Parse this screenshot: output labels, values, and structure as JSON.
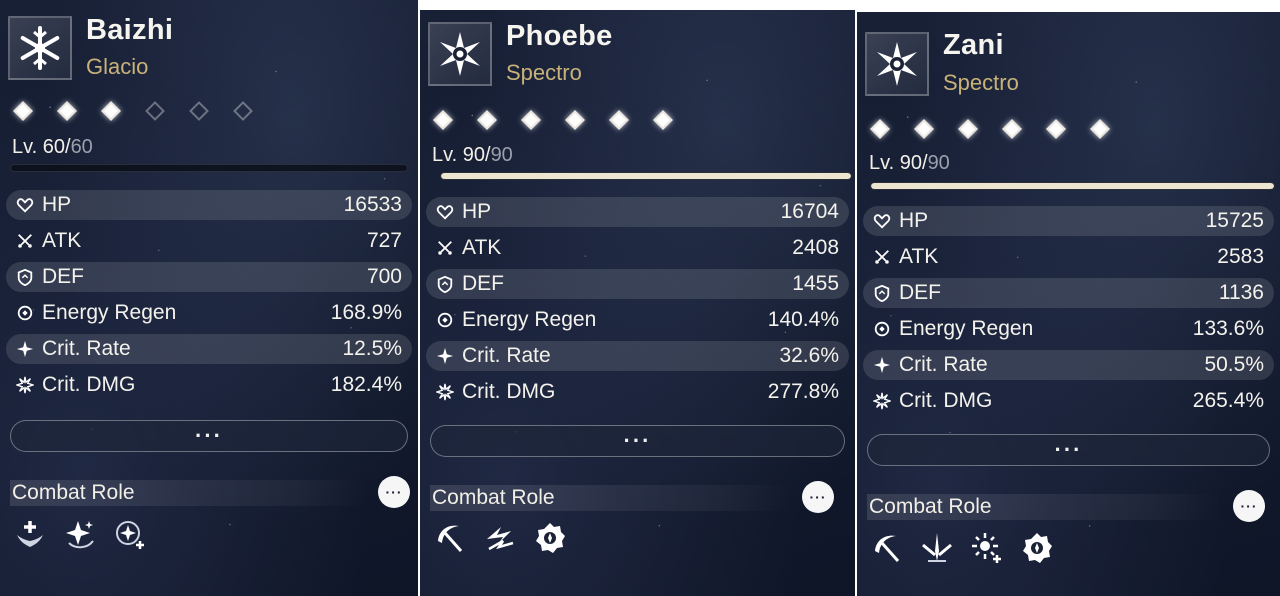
{
  "cards": [
    {
      "name": "Baizhi",
      "element": "Glacio",
      "element_icon": "snowflake-icon",
      "stars_filled": 3,
      "stars_total": 6,
      "level_current": "Lv. 60/",
      "level_max": "60",
      "level_progress": 0,
      "stats": [
        {
          "icon": "hp-heart-icon",
          "label": "HP",
          "value": "16533"
        },
        {
          "icon": "atk-swords-icon",
          "label": "ATK",
          "value": "727"
        },
        {
          "icon": "def-shield-icon",
          "label": "DEF",
          "value": "700"
        },
        {
          "icon": "energy-regen-icon",
          "label": "Energy Regen",
          "value": "168.9%"
        },
        {
          "icon": "crit-rate-icon",
          "label": "Crit. Rate",
          "value": "12.5%"
        },
        {
          "icon": "crit-dmg-icon",
          "label": "Crit. DMG",
          "value": "182.4%"
        }
      ],
      "more_label": "···",
      "combat_role_title": "Combat Role",
      "combat_role_more": "···",
      "roles": [
        "healing-wings-icon",
        "sparkle-buff-icon",
        "star-bonus-icon"
      ]
    },
    {
      "name": "Phoebe",
      "element": "Spectro",
      "element_icon": "spectro-star-icon",
      "stars_filled": 6,
      "stars_total": 6,
      "level_current": "Lv. 90/",
      "level_max": "90",
      "level_progress": 1,
      "stats": [
        {
          "icon": "hp-heart-icon",
          "label": "HP",
          "value": "16704"
        },
        {
          "icon": "atk-swords-icon",
          "label": "ATK",
          "value": "2408"
        },
        {
          "icon": "def-shield-icon",
          "label": "DEF",
          "value": "1455"
        },
        {
          "icon": "energy-regen-icon",
          "label": "Energy Regen",
          "value": "140.4%"
        },
        {
          "icon": "crit-rate-icon",
          "label": "Crit. Rate",
          "value": "32.6%"
        },
        {
          "icon": "crit-dmg-icon",
          "label": "Crit. DMG",
          "value": "277.8%"
        }
      ],
      "more_label": "···",
      "combat_role_title": "Combat Role",
      "combat_role_more": "···",
      "roles": [
        "slash-arc-icon",
        "lightning-strike-icon",
        "gear-emblem-icon"
      ]
    },
    {
      "name": "Zani",
      "element": "Spectro",
      "element_icon": "spectro-star-icon",
      "stars_filled": 6,
      "stars_total": 6,
      "level_current": "Lv. 90/",
      "level_max": "90",
      "level_progress": 1,
      "stats": [
        {
          "icon": "hp-heart-icon",
          "label": "HP",
          "value": "15725"
        },
        {
          "icon": "atk-swords-icon",
          "label": "ATK",
          "value": "2583"
        },
        {
          "icon": "def-shield-icon",
          "label": "DEF",
          "value": "1136"
        },
        {
          "icon": "energy-regen-icon",
          "label": "Energy Regen",
          "value": "133.6%"
        },
        {
          "icon": "crit-rate-icon",
          "label": "Crit. Rate",
          "value": "50.5%"
        },
        {
          "icon": "crit-dmg-icon",
          "label": "Crit. DMG",
          "value": "265.4%"
        }
      ],
      "more_label": "···",
      "combat_role_title": "Combat Role",
      "combat_role_more": "···",
      "roles": [
        "slash-arc-icon",
        "blade-burst-icon",
        "sun-plus-icon",
        "gear-emblem-icon"
      ]
    }
  ]
}
